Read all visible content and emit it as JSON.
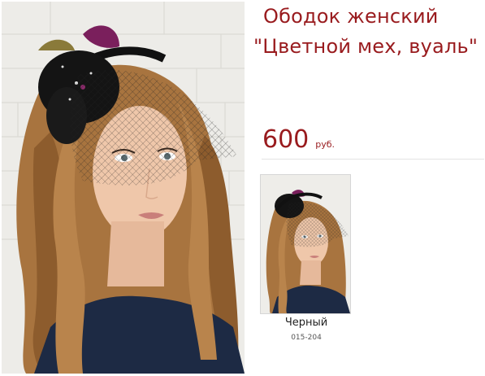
{
  "product": {
    "title_line1": "Ободок женский",
    "title_line2": "\"Цветной мех, вуаль\"",
    "price": "600",
    "currency": "руб."
  },
  "variants": [
    {
      "color_name": "Черный",
      "code": "015-204"
    }
  ],
  "colors": {
    "accent": "#991b1e",
    "divider": "#e3e3e3"
  }
}
